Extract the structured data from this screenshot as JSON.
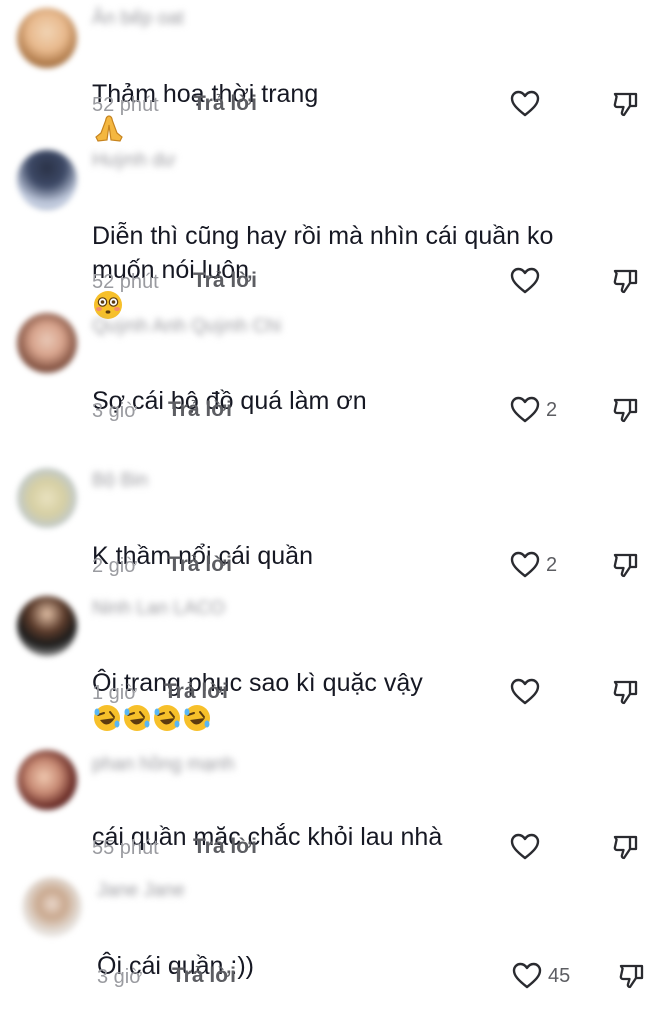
{
  "reply_label": "Trả lời",
  "comments": [
    {
      "username": "Ân bếp oat",
      "text": "Thảm hoạ thời trang",
      "time": "52 phút",
      "likes": ""
    },
    {
      "username": "Huỳnh dư",
      "text": "Diễn thì cũng hay rồi mà nhìn cái quần ko\nmuốn nói luôn",
      "time": "52 phút",
      "likes": ""
    },
    {
      "username": "Quỳnh Anh Quỳnh Chi",
      "text": "Sợ cái bộ đồ quá làm ơn",
      "time": "3 giờ",
      "likes": "2"
    },
    {
      "username": "Bộ Bin",
      "text": "K thầm nổi cái quần",
      "time": "2 giờ",
      "likes": "2"
    },
    {
      "username": "Ninh Lan LACO",
      "text": "Ôi trang phục sao kì quặc vậy",
      "time": "1 giờ",
      "likes": ""
    },
    {
      "username": "phan hồng mạnh",
      "text": "cái quần mặc chắc khỏi lau nhà",
      "time": "55 phút",
      "likes": ""
    },
    {
      "username": "Jane Jane",
      "text": "Ôi cái quần :))",
      "time": "3 giờ",
      "likes": "45"
    }
  ],
  "icons": {
    "like": "heart-outline-icon",
    "dislike": "thumbs-down-icon",
    "emoji_1": "folded-hands-emoji",
    "emoji_2": "flushed-face-emoji",
    "emoji_5": "rolling-on-floor-laughing-emoji"
  },
  "colors": {
    "text": "#161823",
    "meta": "#9a9ba0",
    "reply": "#5c5d62",
    "icon": "#2a2b30"
  }
}
